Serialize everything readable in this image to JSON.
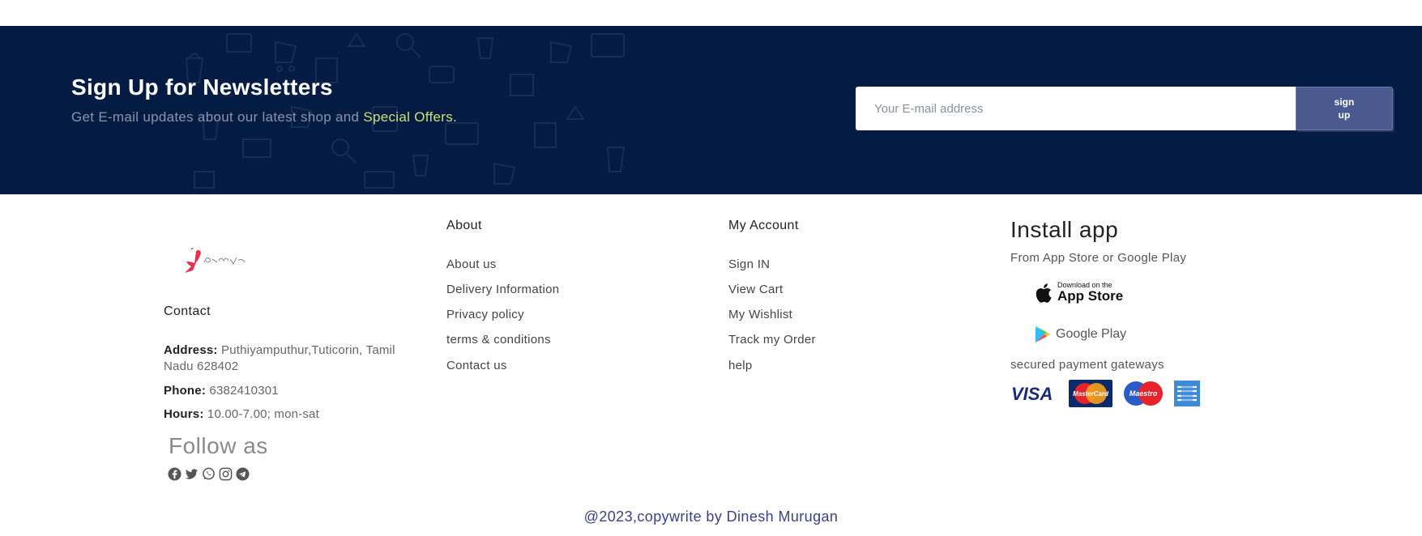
{
  "newsletter": {
    "title": "Sign Up for Newsletters",
    "subtitle_prefix": "Get E-mail updates about our latest shop and",
    "subtitle_highlight": "Special Offers.",
    "input_placeholder": "Your E-mail address",
    "input_value": "",
    "button_label_line1": "sign",
    "button_label_line2": "up"
  },
  "contact": {
    "heading": "Contact",
    "address_label": "Address:",
    "address_value": "Puthiyamputhur,Tuticorin, Tamil Nadu 628402",
    "phone_label": "Phone:",
    "phone_value": "6382410301",
    "hours_label": "Hours:",
    "hours_value": "10.00-7.00; mon-sat",
    "follow_heading": "Follow as",
    "social_icons": [
      "facebook-icon",
      "twitter-icon",
      "whatsapp-icon",
      "instagram-icon",
      "telegram-icon"
    ]
  },
  "about": {
    "heading": "About",
    "links": [
      "About us",
      "Delivery Information",
      "Privacy policy",
      "terms & conditions",
      "Contact us"
    ]
  },
  "account": {
    "heading": "My Account",
    "links": [
      "Sign IN",
      "View Cart",
      "My Wishlist",
      "Track my Order",
      "help"
    ]
  },
  "install": {
    "heading": "Install app",
    "subtitle": "From App Store or Google Play",
    "appstore_small": "Download on the",
    "appstore_big": "App Store",
    "gplay_label": "Google Play",
    "secured_text": "secured payment gateways",
    "payment_cards": [
      "VISA",
      "MasterCard",
      "Maestro",
      "American Express"
    ]
  },
  "footer": {
    "copyright": "@2023,copywrite by Dinesh Murugan"
  },
  "colors": {
    "newsletter_bg": "#041c44",
    "highlight": "#cde26b",
    "button_bg": "#4b5a8e",
    "copyright": "#3b3f8c"
  }
}
